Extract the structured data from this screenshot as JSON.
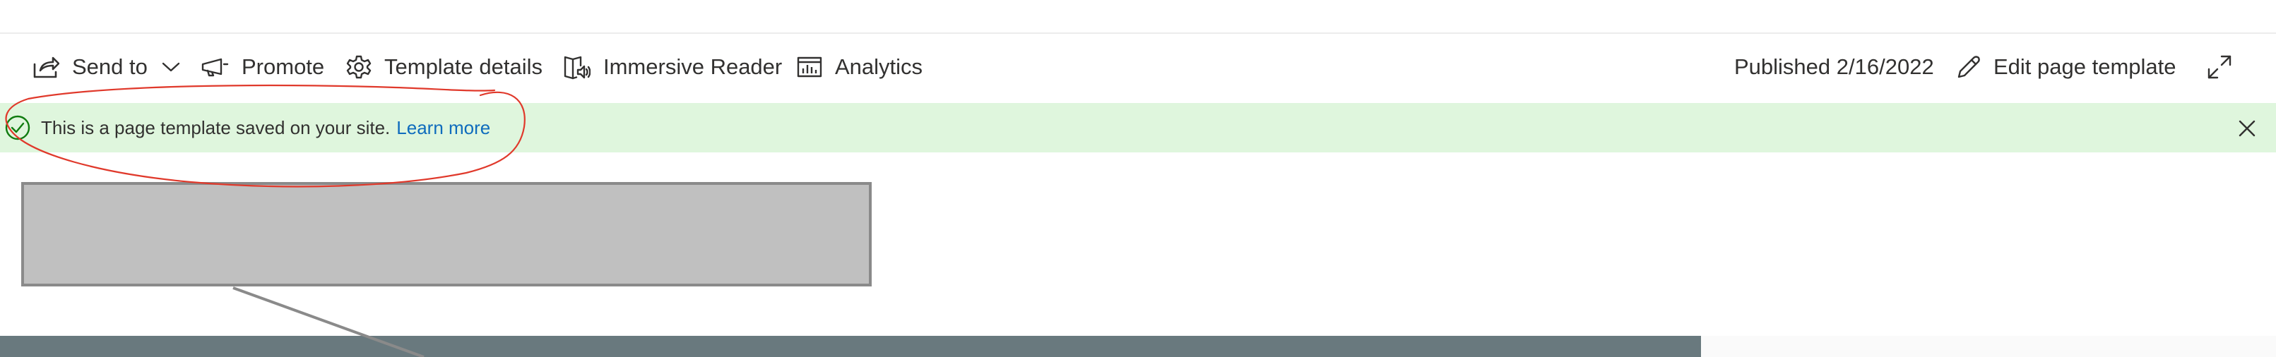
{
  "commandbar": {
    "send_to": "Send to",
    "promote": "Promote",
    "template_details": "Template details",
    "immersive_reader": "Immersive Reader",
    "analytics": "Analytics",
    "published": "Published 2/16/2022",
    "edit_page_template": "Edit page template"
  },
  "banner": {
    "message": "This is a page template saved on your site.",
    "link": "Learn more",
    "color": "#dff6dd",
    "link_color": "#0f6cbd",
    "success_color": "#107c10"
  },
  "icons": {
    "send_to": "share-arrow-icon",
    "send_to_dropdown": "chevron-down-icon",
    "promote": "megaphone-icon",
    "template_details": "gear-icon",
    "immersive_reader": "immersive-reader-icon",
    "analytics": "bar-chart-icon",
    "edit": "pencil-icon",
    "expand": "expand-icon",
    "banner_status": "check-circle-icon",
    "banner_close": "close-icon"
  },
  "annotation": {
    "type": "hand-drawn ellipse",
    "color": "#e0392b"
  }
}
